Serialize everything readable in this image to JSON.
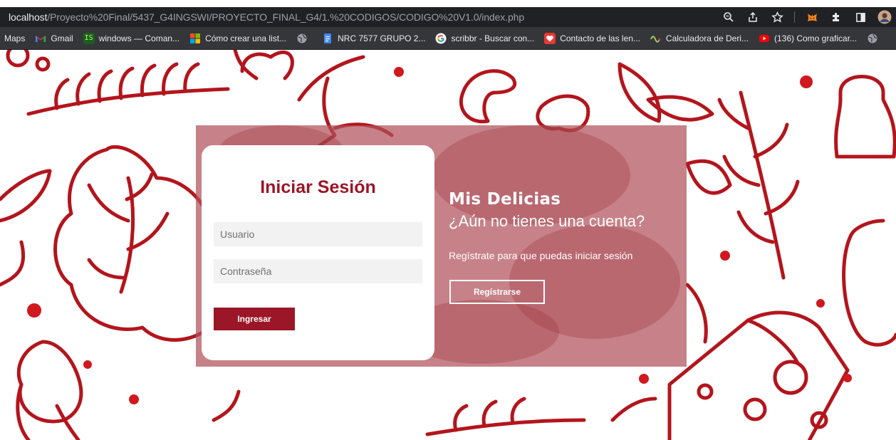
{
  "browser": {
    "url_host": "localhost",
    "url_path": "/Proyecto%20Final/5437_G4INGSWI/PROYECTO_FINAL_G4/1.%20CODIGOS/CODIGO%20V1.0/index.php",
    "toolbar_icons": [
      "zoom-icon",
      "share-icon",
      "star-icon",
      "extension-metamask-icon",
      "puzzle-icon",
      "sidepanel-icon",
      "profile-avatar"
    ]
  },
  "bookmarks": [
    {
      "label": "Maps",
      "icon": "maps-icon",
      "color": "#35363a"
    },
    {
      "label": "Gmail",
      "icon": "gmail-icon",
      "color": "#ea4335"
    },
    {
      "label": "windows — Coman...",
      "icon": "terminal-icon",
      "color": "#2e7d32"
    },
    {
      "label": "Cómo crear una list...",
      "icon": "microsoft-icon",
      "color": "#f25022"
    },
    {
      "label": "",
      "icon": "globe-icon",
      "color": "#9aa0a6"
    },
    {
      "label": "NRC 7577 GRUPO 2...",
      "icon": "docs-icon",
      "color": "#4285f4"
    },
    {
      "label": "scribbr - Buscar con...",
      "icon": "google-icon",
      "color": "#ffffff"
    },
    {
      "label": "Contacto de las len...",
      "icon": "heart-icon",
      "color": "#e53935"
    },
    {
      "label": "Calculadora de Deri...",
      "icon": "wave-icon",
      "color": "#9ccc65"
    },
    {
      "label": "(136) Como graficar...",
      "icon": "youtube-icon",
      "color": "#ff0000"
    },
    {
      "label": "",
      "icon": "globe-icon",
      "color": "#9aa0a6"
    }
  ],
  "login": {
    "title": "Iniciar Sesión",
    "user_placeholder": "Usuario",
    "user_value": "",
    "pass_placeholder": "Contraseña",
    "pass_value": "",
    "submit_label": "Ingresar"
  },
  "promo": {
    "brand": "Mis Delicias",
    "question": "¿Aún no tienes una cuenta?",
    "subtitle": "Regístrate para que puedas iniciar sesión",
    "register_label": "Regístrarse"
  },
  "colors": {
    "accent": "#9b1626",
    "art": "#b3151c",
    "panel": "#b0525a"
  }
}
